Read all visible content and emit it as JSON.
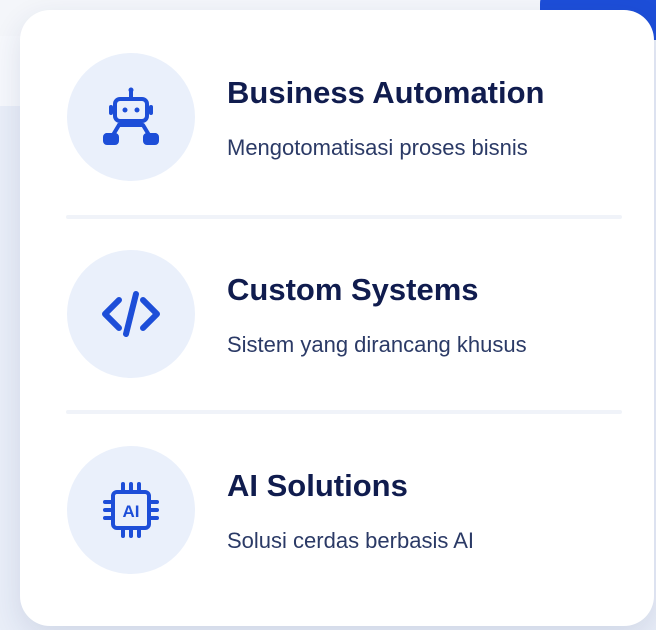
{
  "colors": {
    "icon_blue": "#1d4ed8",
    "title_color": "#101c4e",
    "subtitle_color": "#2b3a66",
    "icon_circle_bg": "#eaf0fb"
  },
  "services": [
    {
      "title": "Business Automation",
      "subtitle": "Mengotomatisasi proses bisnis",
      "icon": "robot-icon"
    },
    {
      "title": "Custom Systems",
      "subtitle": "Sistem yang dirancang khusus",
      "icon": "code-icon"
    },
    {
      "title": "AI Solutions",
      "subtitle": "Solusi cerdas berbasis AI",
      "icon": "ai-chip-icon",
      "icon_label": "AI"
    }
  ]
}
